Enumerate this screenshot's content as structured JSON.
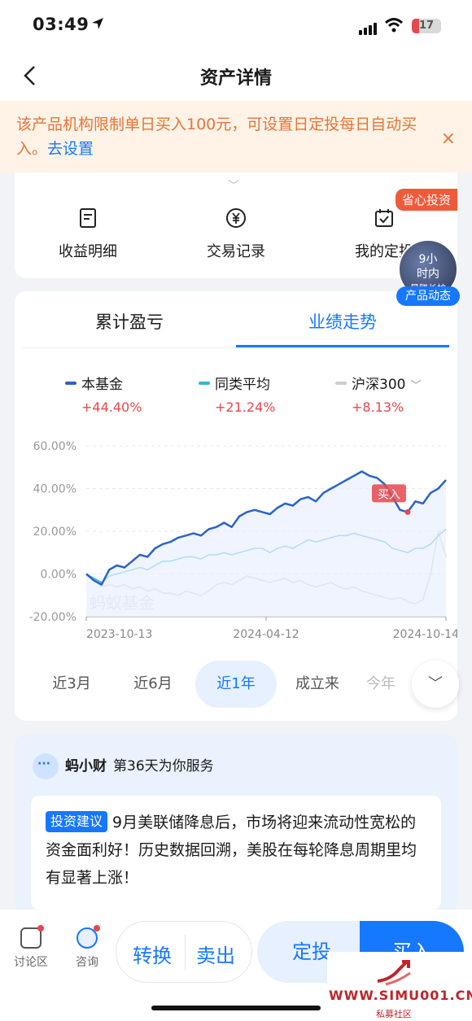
{
  "status_bar": {
    "time": "03:49",
    "battery": "17"
  },
  "nav": {
    "title": "资产详情"
  },
  "notice": {
    "text": "该产品机构限制单日买入100元，可设置日定投每日自动买入。",
    "link": "去设置",
    "close": "×"
  },
  "actions": [
    {
      "label": "收益明细",
      "icon": "document-icon"
    },
    {
      "label": "交易记录",
      "icon": "yen-circle-icon"
    },
    {
      "label": "我的定投",
      "icon": "calendar-icon"
    }
  ],
  "promo_badge": "省心投资",
  "float_ad": {
    "line1": "9小",
    "line2": "时内",
    "line3": "暴赚长护",
    "pill": "产品动态"
  },
  "chart_tabs": [
    {
      "label": "累计盈亏"
    },
    {
      "label": "业绩走势"
    }
  ],
  "legend": [
    {
      "name": "本基金",
      "value": "+44.40%",
      "color": "#2a63c9"
    },
    {
      "name": "同类平均",
      "value": "+21.24%",
      "color": "#33b7d9"
    },
    {
      "name": "沪深300",
      "value": "+8.13%",
      "color": "#cccccc"
    }
  ],
  "chart_watermark": "蚂蚁基金",
  "buy_marker": "买入",
  "chart_data": {
    "type": "line",
    "x_ticks": [
      "2023-10-13",
      "2024-04-12",
      "2024-10-14"
    ],
    "y_ticks": [
      "60.00%",
      "40.00%",
      "20.00%",
      "0.00%",
      "-20.00%"
    ],
    "ylim": [
      -20,
      60
    ],
    "grid": true,
    "series": [
      {
        "name": "本基金",
        "color": "#2a63c9",
        "values": [
          0,
          -3,
          -5,
          2,
          4,
          3,
          6,
          9,
          8,
          12,
          14,
          15,
          17,
          18,
          19,
          18,
          21,
          22,
          24,
          22,
          27,
          29,
          30,
          29,
          28,
          31,
          33,
          32,
          35,
          36,
          34,
          38,
          40,
          42,
          44,
          46,
          48,
          46,
          45,
          42,
          36,
          30,
          29,
          34,
          33,
          38,
          40,
          44
        ]
      },
      {
        "name": "同类平均",
        "color": "#33b7d9",
        "values": [
          0,
          -2,
          -4,
          -1,
          0,
          1,
          2,
          3,
          2,
          4,
          6,
          6,
          7,
          8,
          8,
          7,
          9,
          9,
          10,
          9,
          10,
          11,
          12,
          12,
          10,
          12,
          13,
          12,
          14,
          16,
          15,
          16,
          17,
          18,
          18,
          19,
          18,
          17,
          16,
          15,
          12,
          11,
          10,
          12,
          12,
          14,
          18,
          21
        ]
      },
      {
        "name": "沪深300",
        "color": "#cccccc",
        "values": [
          0,
          -3,
          -6,
          -5,
          -6,
          -5,
          -7,
          -6,
          -8,
          -7,
          -9,
          -9,
          -10,
          -8,
          -9,
          -10,
          -8,
          -5,
          -4,
          -5,
          -3,
          -1,
          -2,
          -3,
          -4,
          -3,
          -2,
          -4,
          -3,
          -5,
          -6,
          -5,
          -4,
          -6,
          -7,
          -6,
          -8,
          -9,
          -10,
          -11,
          -12,
          -11,
          -13,
          -14,
          -12,
          0,
          20,
          8
        ]
      }
    ]
  },
  "periods": [
    {
      "label": "近3月"
    },
    {
      "label": "近6月"
    },
    {
      "label": "近1年"
    },
    {
      "label": "成立来"
    },
    {
      "label": "今年"
    }
  ],
  "ai": {
    "name": "蚂小财",
    "subtitle": "第36天为你服务",
    "tag": "投资建议",
    "text": "9月美联储降息后，市场将迎来流动性宽松的资金面利好！历史数据回溯，美股在每轮降息周期里均有显著上涨！"
  },
  "bottom": {
    "discuss": "讨论区",
    "consult": "咨询",
    "convert": "转换",
    "sell": "卖出",
    "fixed": "定投",
    "buy": "买入"
  },
  "watermark": {
    "url": "WWW.SIMU001.CN",
    "sub": "私募社区"
  }
}
